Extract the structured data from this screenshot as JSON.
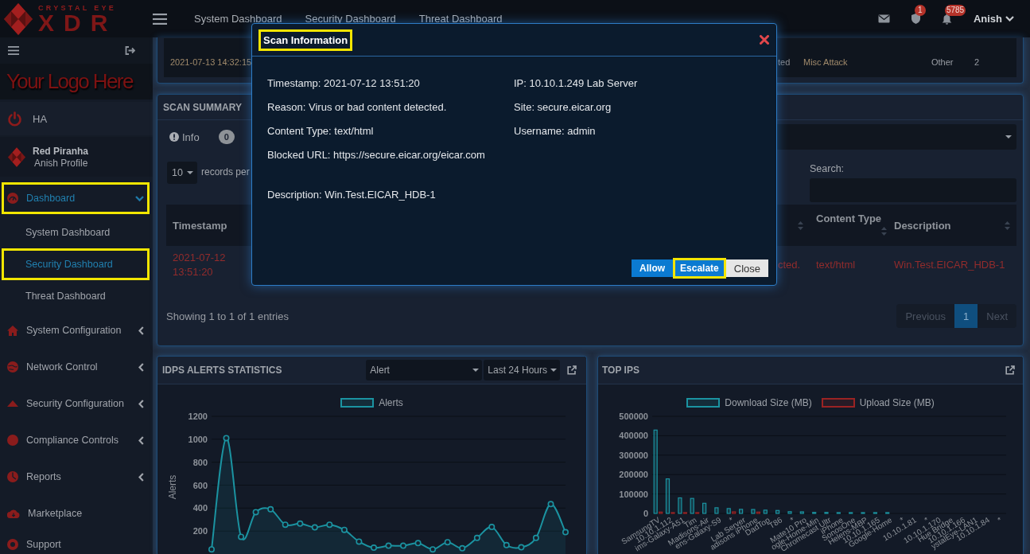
{
  "header": {
    "logo": {
      "tagline": "CRYSTAL EYE",
      "wordmark": "XDR"
    },
    "nav": [
      "System Dashboard",
      "Security Dashboard",
      "Threat Dashboard"
    ],
    "notifications": [
      {
        "kind": "mail"
      },
      {
        "kind": "shield",
        "badge": "1"
      },
      {
        "kind": "bell",
        "badge": "5785"
      }
    ],
    "user": "Anish"
  },
  "sidebar": {
    "logo_placeholder": "Your Logo Here",
    "ha": "HA",
    "profile": {
      "name": "Red Piranha",
      "subtitle": "Anish Profile"
    },
    "menu": [
      {
        "label": "Dashboard",
        "kind": "submenu",
        "expanded": true,
        "selected": true,
        "highlighted": true,
        "children": [
          {
            "label": "System Dashboard",
            "selected": false,
            "highlighted": false
          },
          {
            "label": "Security Dashboard",
            "selected": true,
            "highlighted": true
          },
          {
            "label": "Threat Dashboard",
            "selected": false,
            "highlighted": false
          }
        ]
      },
      {
        "label": "System Configuration",
        "kind": "submenu",
        "expanded": false,
        "selected": false,
        "highlighted": false
      },
      {
        "label": "Network Control",
        "kind": "submenu",
        "expanded": false,
        "selected": false,
        "highlighted": false
      },
      {
        "label": "Security Configuration",
        "kind": "submenu",
        "expanded": false,
        "selected": false,
        "highlighted": false
      },
      {
        "label": "Compliance Controls",
        "kind": "submenu",
        "expanded": false,
        "selected": false,
        "highlighted": false
      },
      {
        "label": "Reports",
        "kind": "submenu",
        "expanded": false,
        "selected": false,
        "highlighted": false
      },
      {
        "label": "Marketplace",
        "kind": "link",
        "selected": false,
        "highlighted": false
      },
      {
        "label": "Support",
        "kind": "link",
        "selected": false,
        "highlighted": false
      }
    ]
  },
  "alerts_table": {
    "cells": [
      "2021-07-13 14:32:15",
      "ted",
      "Misc Attack",
      "Other",
      "2"
    ]
  },
  "scan_summary": {
    "title": "SCAN SUMMARY",
    "filters": [
      {
        "label": "Info",
        "count": "0"
      }
    ],
    "page_length": "10",
    "page_length_label": "records per",
    "search_label": "Search:",
    "columns": [
      "Timestamp",
      "",
      "Content Type",
      "Description"
    ],
    "rows": [
      [
        "2021-07-12 13:51:20",
        "cted.",
        "text/html",
        "Win.Test.EICAR_HDB-1"
      ]
    ],
    "info": "Showing 1 to 1 of 1 entries",
    "pagination": {
      "previous": {
        "label": "Previous",
        "disabled": true
      },
      "pages": [
        {
          "label": "1",
          "selected": true
        }
      ],
      "next": {
        "label": "Next",
        "disabled": true
      }
    }
  },
  "idps_alerts": {
    "title": "IDPS ALERTS STATISTICS",
    "selects": [
      "Alert",
      "Last 24 Hours"
    ],
    "chart_data": {
      "type": "area",
      "ylabel": "Alerts",
      "series": [
        {
          "name": "Alerts",
          "color": "#1b93a1",
          "values": [
            40,
            1010,
            150,
            365,
            390,
            255,
            265,
            232,
            255,
            210,
            108,
            55,
            72,
            72,
            95,
            40,
            103,
            50,
            140,
            235,
            78,
            58,
            140,
            435,
            190
          ]
        }
      ],
      "ylim": [
        0,
        1200
      ],
      "yticks": [
        200,
        400,
        600,
        800,
        1000,
        1200
      ],
      "grid": true
    }
  },
  "top_ips": {
    "title": "TOP IPS",
    "chart_data": {
      "type": "bar",
      "categories": [
        "SamsungTV",
        "10.10.1.112",
        "ims-Galaxy-A51",
        "Tim",
        "Madisons-Air",
        "ens-Galaxy-S9",
        "*",
        "Lab Server",
        "adisons iPhone",
        "DadTop",
        "T86",
        "*",
        "Mate10 Pro",
        "ogle-Home-Min",
        "Chromecast Ultr",
        "iPhone",
        "SonosOne",
        "Helens-MBP",
        "10.10.1.165",
        "Google-Home",
        "*",
        "10.10.1.81",
        "*",
        "10.10.1.170",
        "Hue Bridge",
        "10.10.1.166",
        "ystalEye-LAN1",
        "10.10.1.84",
        "*"
      ],
      "series": [
        {
          "name": "Download Size (MB)",
          "color": "#1b93a1",
          "values": [
            429000,
            178000,
            80000,
            77000,
            52000,
            29000,
            25000,
            21000,
            20000,
            17000,
            15000,
            9000,
            8000,
            5000,
            5000,
            4000,
            3000,
            2000,
            2000,
            1000,
            0,
            0,
            0,
            0,
            0,
            0,
            0,
            0,
            0
          ]
        },
        {
          "name": "Upload Size (MB)",
          "color": "#9a2323",
          "values": [
            7000,
            1000,
            4000,
            1000,
            0,
            0,
            8000,
            0,
            7000,
            0,
            0,
            0,
            0,
            0,
            0,
            0,
            0,
            0,
            0,
            0,
            0,
            0,
            0,
            0,
            0,
            0,
            0,
            0,
            0
          ]
        }
      ],
      "ylim": [
        0,
        500000
      ],
      "yticks": [
        0,
        100000,
        200000,
        300000,
        400000,
        500000
      ],
      "grid": true
    }
  },
  "modal": {
    "title": "Scan Information",
    "title_highlighted": true,
    "details_left": [
      "Timestamp: 2021-07-12 13:51:20",
      "Reason: Virus or bad content detected.",
      "Content Type: text/html",
      "Blocked URL: https://secure.eicar.org/eicar.com"
    ],
    "details_right": [
      "IP: 10.10.1.249 Lab Server",
      "Site: secure.eicar.org",
      "Username: admin"
    ],
    "description": "Description: Win.Test.EICAR_HDB-1",
    "buttons": [
      {
        "label": "Allow",
        "kind": "primary",
        "highlighted": false
      },
      {
        "label": "Escalate",
        "kind": "primary",
        "highlighted": true
      },
      {
        "label": "Close",
        "kind": "default",
        "highlighted": false
      }
    ]
  }
}
